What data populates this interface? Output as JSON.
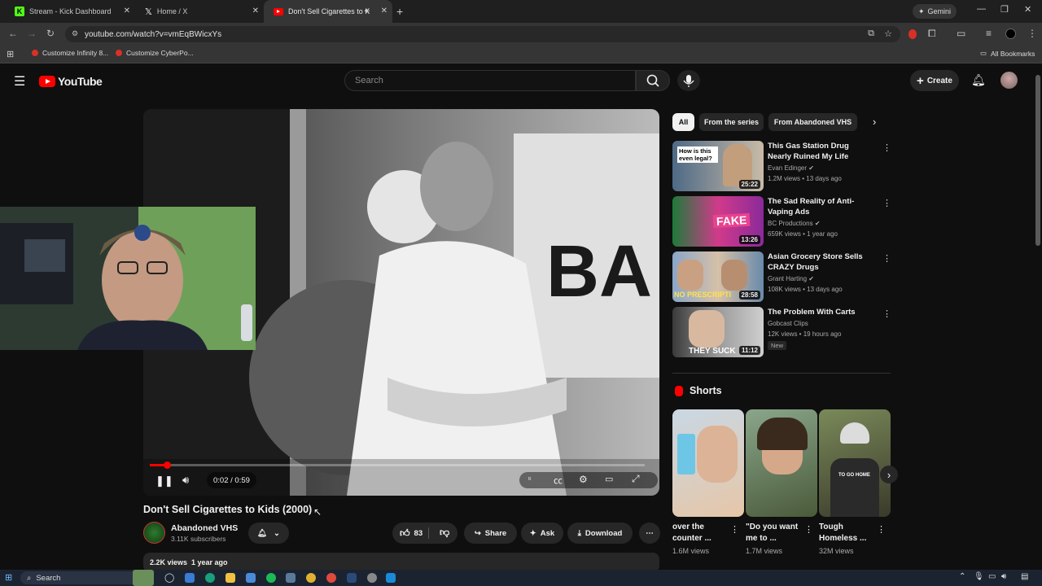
{
  "browser": {
    "tabs": [
      {
        "title": "Stream - Kick Dashboard"
      },
      {
        "title": "Home / X"
      },
      {
        "title": "Don't Sell Cigarettes to Kids"
      }
    ],
    "gemini_label": "Gemini",
    "url": "youtube.com/watch?v=vmEqBWicxYs",
    "bookmarks": [
      "Customize Infinity 8...",
      "Customize CyberPo..."
    ],
    "all_bookmarks": "All Bookmarks"
  },
  "youtube": {
    "logo_text": "YouTube",
    "search_placeholder": "Search",
    "create_label": "Create"
  },
  "player": {
    "time": "0:02 / 0:59",
    "progress": 0.034
  },
  "video": {
    "title": "Don't Sell Cigarettes to Kids (2000)",
    "channel": "Abandoned VHS",
    "subscribers": "3.11K subscribers",
    "likes": "83",
    "share_label": "Share",
    "ask_label": "Ask",
    "download_label": "Download",
    "views_date": "2.2K views  1 year ago"
  },
  "chips": [
    "All",
    "From the series",
    "From Abandoned VHS"
  ],
  "recommendations": [
    {
      "title": "This Gas Station Drug Nearly Ruined My Life",
      "channel": "Evan Edinger",
      "meta": "1.2M views • 13 days ago",
      "duration": "25:22",
      "thumb_text": "How is this even legal?"
    },
    {
      "title": "The Sad Reality of Anti-Vaping Ads",
      "channel": "BC Productions",
      "meta": "659K views • 1 year ago",
      "duration": "13:26",
      "thumb_text": "FAKE"
    },
    {
      "title": "Asian Grocery Store Sells CRAZY Drugs",
      "channel": "Grant Harting",
      "meta": "108K views • 13 days ago",
      "duration": "28:58",
      "thumb_text": "NO PRESCRIPTI"
    },
    {
      "title": "The Problem With Carts",
      "channel": "Gobcast Clips",
      "meta": "12K views • 19 hours ago",
      "duration": "11:12",
      "thumb_text": "THEY SUCK",
      "badge": "New"
    }
  ],
  "shorts": {
    "heading": "Shorts",
    "items": [
      {
        "title": "over the counter ...",
        "views": "1.6M views"
      },
      {
        "title": "\"Do you want me to ...",
        "views": "1.7M views"
      },
      {
        "title": "Tough Homeless ...",
        "views": "32M views",
        "thumb_text": "TO GO HOME"
      }
    ]
  },
  "taskbar": {
    "search_label": "Search"
  },
  "colors": {
    "accent": "#ff0000",
    "background": "#0f0f0f",
    "kick": "#53fc18"
  }
}
